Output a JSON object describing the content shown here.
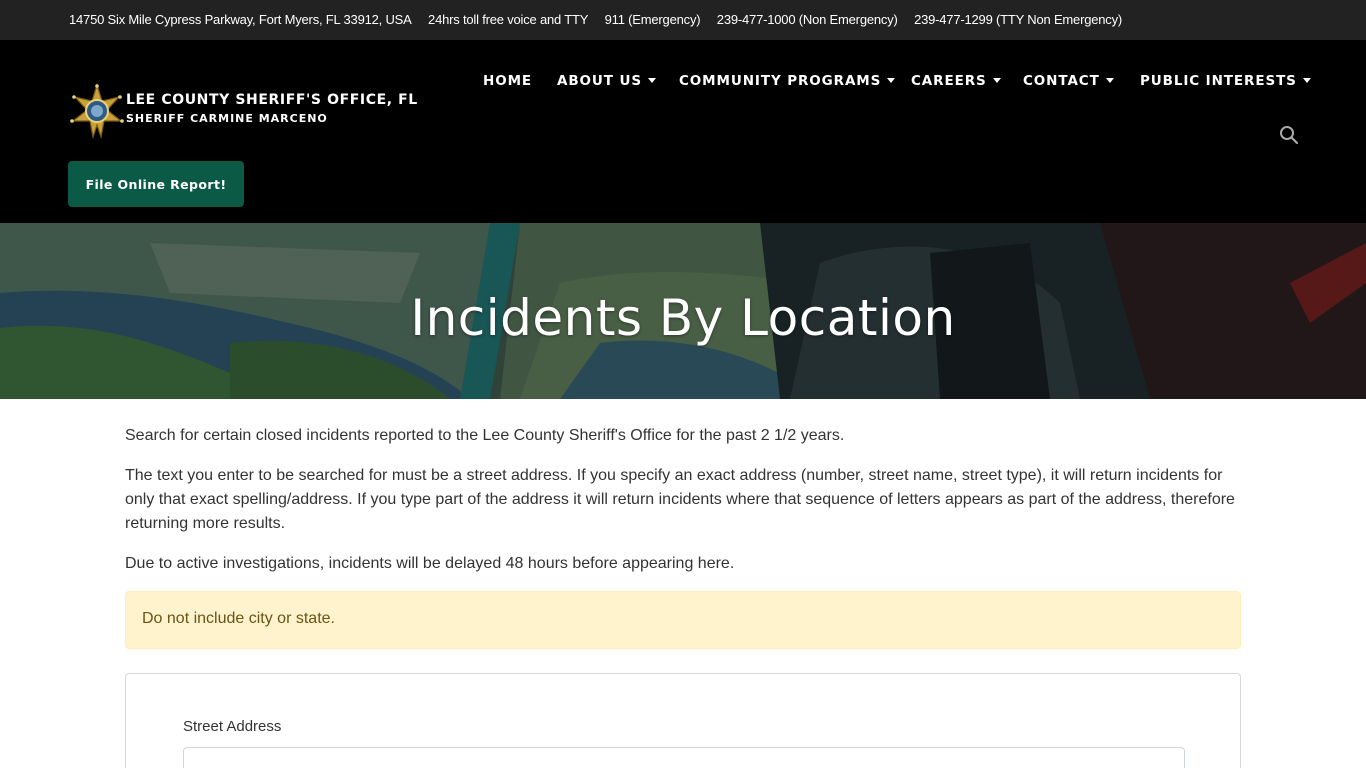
{
  "topbar": {
    "address": "14750 Six Mile Cypress Parkway, Fort Myers, FL 33912, USA",
    "tty": "24hrs toll free voice and TTY",
    "emergency": "911 (Emergency)",
    "non_emergency": "239-477-1000 (Non Emergency)",
    "tty_non_emergency": "239-477-1299 (TTY Non Emergency)"
  },
  "brand": {
    "title": "LEE COUNTY SHERIFF'S OFFICE, FL",
    "subtitle": "SHERIFF CARMINE MARCENO",
    "logo_icon": "sheriff-star-badge-icon"
  },
  "nav": {
    "items": [
      {
        "label": "HOME",
        "dropdown": false
      },
      {
        "label": "ABOUT US",
        "dropdown": true
      },
      {
        "label": "COMMUNITY PROGRAMS",
        "dropdown": true
      },
      {
        "label": "CAREERS",
        "dropdown": true
      },
      {
        "label": "CONTACT",
        "dropdown": true
      },
      {
        "label": "PUBLIC INTERESTS",
        "dropdown": true
      }
    ],
    "search_icon": "search-icon"
  },
  "cta": {
    "label": "File Online Report!"
  },
  "hero": {
    "title": "Incidents By Location"
  },
  "content": {
    "p1": "Search for certain closed incidents reported to the Lee County Sheriff's Office for the past 2 1/2 years.",
    "p2": "The text you enter to be searched for must be a street address. If you specify an exact address (number, street name, street type), it will return incidents for only that exact spelling/address. If you type part of the address it will return incidents where that sequence of letters appears as part of the address, therefore returning more results.",
    "p3": "Due to active investigations, incidents will be delayed 48 hours before appearing here.",
    "alert": "Do not include city or state."
  },
  "form": {
    "street_label": "Street Address",
    "street_value": ""
  },
  "colors": {
    "topbar_bg": "#222222",
    "header_bg": "#000000",
    "cta_bg": "#0b5a45",
    "alert_bg": "#fff3cd"
  }
}
